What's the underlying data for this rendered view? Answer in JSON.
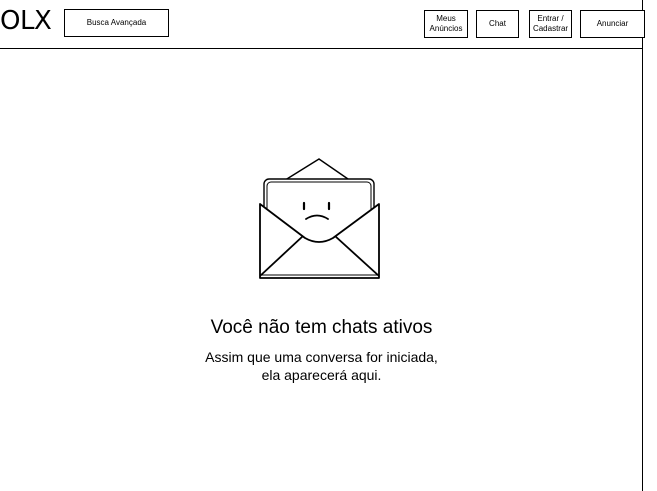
{
  "header": {
    "logo": "OLX",
    "search_button": "Busca Avançada",
    "nav": {
      "my_ads_line1": "Meus",
      "my_ads_line2": "Anúncios",
      "chat": "Chat",
      "login_line1": "Entrar /",
      "login_line2": "Cadastrar",
      "sell": "Anunciar"
    }
  },
  "empty_state": {
    "illustration": "sad-envelope-icon",
    "title": "Você não tem chats ativos",
    "description_line1": "Assim que uma conversa for iniciada,",
    "description_line2": "ela aparecerá aqui."
  }
}
